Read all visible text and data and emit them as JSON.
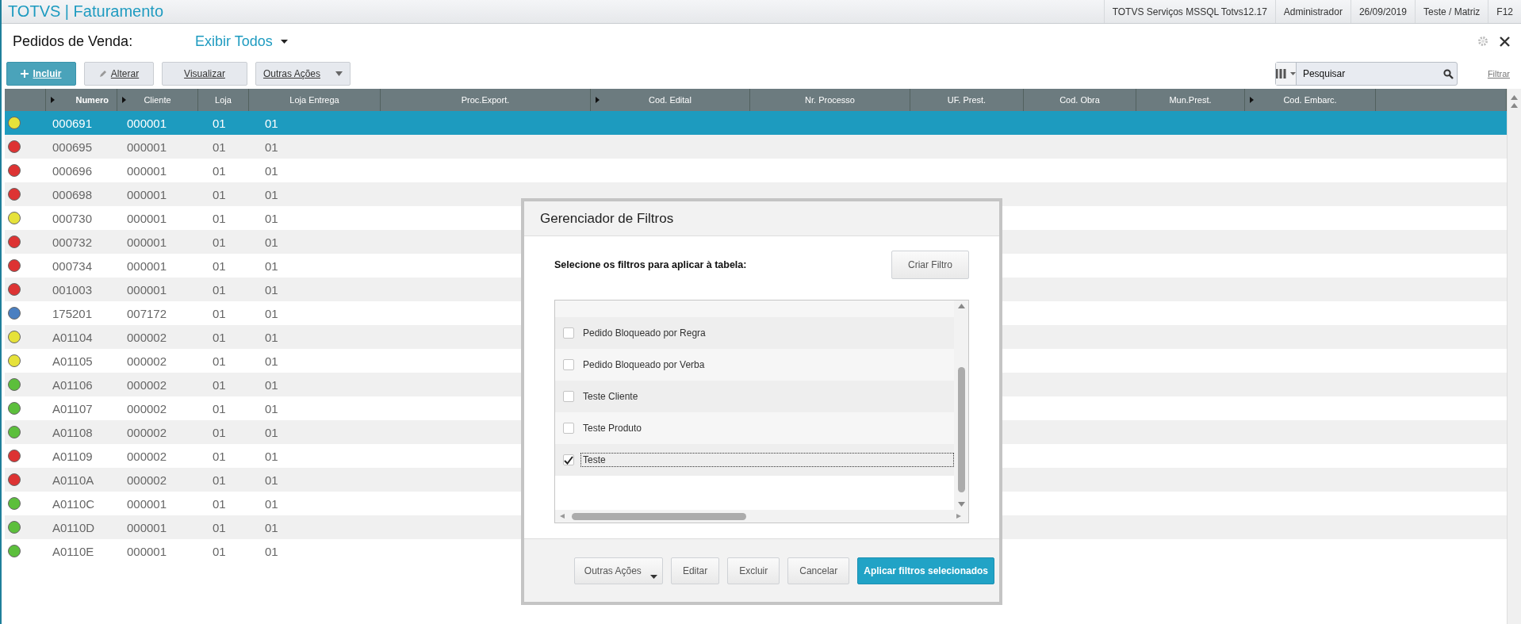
{
  "app_title": "TOTVS | Faturamento",
  "status_items": [
    "TOTVS Serviços MSSQL Totvs12.17",
    "Administrador",
    "26/09/2019",
    "Teste / Matriz",
    "F12"
  ],
  "page_title": "Pedidos de Venda:",
  "view_selector": "Exibir Todos",
  "actions": [
    {
      "kind": "primary",
      "label": "Incluir"
    },
    {
      "kind": "edit",
      "label": "Alterar"
    },
    {
      "kind": "plain",
      "label": "Visualizar"
    },
    {
      "kind": "menu",
      "label": "Outras Ações"
    }
  ],
  "search": {
    "placeholder": "Pesquisar"
  },
  "filter_link": "Filtrar",
  "table": {
    "columns": [
      {
        "label": "Numero",
        "sortable": true
      },
      {
        "label": "Cliente",
        "sortable": true
      },
      {
        "label": "Loja",
        "sortable": false
      },
      {
        "label": "Loja Entrega",
        "sortable": false
      },
      {
        "label": "Proc.Export.",
        "sortable": false
      },
      {
        "label": "Cod. Edital",
        "sortable": true
      },
      {
        "label": "Nr. Processo",
        "sortable": false
      },
      {
        "label": "UF. Prest.",
        "sortable": false
      },
      {
        "label": "Cod. Obra",
        "sortable": false
      },
      {
        "label": "Mun.Prest.",
        "sortable": false
      },
      {
        "label": "Cod. Embarc.",
        "sortable": true
      }
    ],
    "rows": [
      {
        "color": "#e6e23a",
        "selected": true,
        "cells": [
          "000691",
          "000001",
          "01",
          "01"
        ]
      },
      {
        "color": "#dd3333",
        "selected": false,
        "cells": [
          "000695",
          "000001",
          "01",
          "01"
        ]
      },
      {
        "color": "#dd3333",
        "selected": false,
        "cells": [
          "000696",
          "000001",
          "01",
          "01"
        ]
      },
      {
        "color": "#dd3333",
        "selected": false,
        "cells": [
          "000698",
          "000001",
          "01",
          "01"
        ]
      },
      {
        "color": "#e6e23a",
        "selected": false,
        "cells": [
          "000730",
          "000001",
          "01",
          "01"
        ]
      },
      {
        "color": "#dd3333",
        "selected": false,
        "cells": [
          "000732",
          "000001",
          "01",
          "01"
        ]
      },
      {
        "color": "#dd3333",
        "selected": false,
        "cells": [
          "000734",
          "000001",
          "01",
          "01"
        ]
      },
      {
        "color": "#dd3333",
        "selected": false,
        "cells": [
          "001003",
          "000001",
          "01",
          "01"
        ]
      },
      {
        "color": "#4a7fc1",
        "selected": false,
        "cells": [
          "175201",
          "007172",
          "01",
          "01"
        ]
      },
      {
        "color": "#e6e23a",
        "selected": false,
        "cells": [
          "A01104",
          "000002",
          "01",
          "01"
        ]
      },
      {
        "color": "#e6e23a",
        "selected": false,
        "cells": [
          "A01105",
          "000002",
          "01",
          "01"
        ]
      },
      {
        "color": "#5cbf3c",
        "selected": false,
        "cells": [
          "A01106",
          "000002",
          "01",
          "01"
        ]
      },
      {
        "color": "#5cbf3c",
        "selected": false,
        "cells": [
          "A01107",
          "000002",
          "01",
          "01"
        ]
      },
      {
        "color": "#5cbf3c",
        "selected": false,
        "cells": [
          "A01108",
          "000002",
          "01",
          "01"
        ]
      },
      {
        "color": "#dd3333",
        "selected": false,
        "cells": [
          "A01109",
          "000002",
          "01",
          "01"
        ]
      },
      {
        "color": "#dd3333",
        "selected": false,
        "cells": [
          "A0110A",
          "000002",
          "01",
          "01"
        ]
      },
      {
        "color": "#5cbf3c",
        "selected": false,
        "cells": [
          "A0110C",
          "000001",
          "01",
          "01"
        ]
      },
      {
        "color": "#5cbf3c",
        "selected": false,
        "cells": [
          "A0110D",
          "000001",
          "01",
          "01"
        ]
      },
      {
        "color": "#5cbf3c",
        "selected": false,
        "cells": [
          "A0110E",
          "000001",
          "01",
          "01"
        ]
      }
    ]
  },
  "dialog": {
    "title": "Gerenciador de Filtros",
    "prompt": "Selecione os filtros para aplicar à tabela:",
    "create_button": "Criar Filtro",
    "filters": [
      {
        "label": "Pedido Bloqueado por Regra",
        "checked": false,
        "focused": false
      },
      {
        "label": "Pedido Bloqueado por Verba",
        "checked": false,
        "focused": false
      },
      {
        "label": "Teste Cliente",
        "checked": false,
        "focused": false
      },
      {
        "label": "Teste Produto",
        "checked": false,
        "focused": false
      },
      {
        "label": "Teste",
        "checked": true,
        "focused": true
      }
    ],
    "buttons": [
      {
        "kind": "menu",
        "label": "Outras Ações"
      },
      {
        "kind": "plain",
        "label": "Editar"
      },
      {
        "kind": "plain",
        "label": "Excluir"
      },
      {
        "kind": "plain",
        "label": "Cancelar"
      },
      {
        "kind": "primary",
        "label": "Aplicar filtros selecionados"
      }
    ]
  }
}
